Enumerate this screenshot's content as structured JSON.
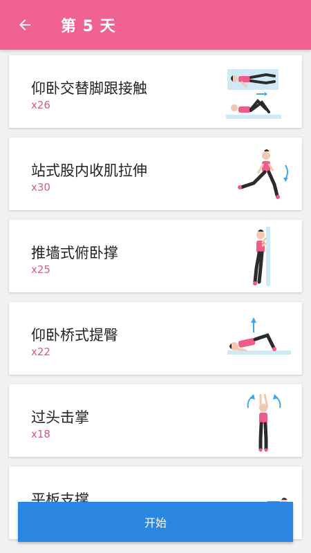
{
  "header": {
    "title": "第 5 天",
    "back_icon": "arrow-left-icon",
    "color": "#f06292"
  },
  "exercises": [
    {
      "name": "仰卧交替脚跟接触",
      "reps": "x26",
      "icon": "heel-touch-illustration"
    },
    {
      "name": "站式股内收肌拉伸",
      "reps": "x30",
      "icon": "side-lunge-stretch-illustration"
    },
    {
      "name": "推墙式俯卧撑",
      "reps": "x25",
      "icon": "wall-pushup-illustration"
    },
    {
      "name": "仰卧桥式提臀",
      "reps": "x22",
      "icon": "glute-bridge-illustration"
    },
    {
      "name": "过头击掌",
      "reps": "x18",
      "icon": "overhead-clap-illustration"
    },
    {
      "name": "平板支撑",
      "reps": "",
      "icon": "plank-illustration"
    }
  ],
  "start_button": {
    "label": "开始",
    "color": "#2a86e0"
  },
  "colors": {
    "accent": "#f06292",
    "reps_text": "#d65a87",
    "background": "#f1f1f1"
  }
}
